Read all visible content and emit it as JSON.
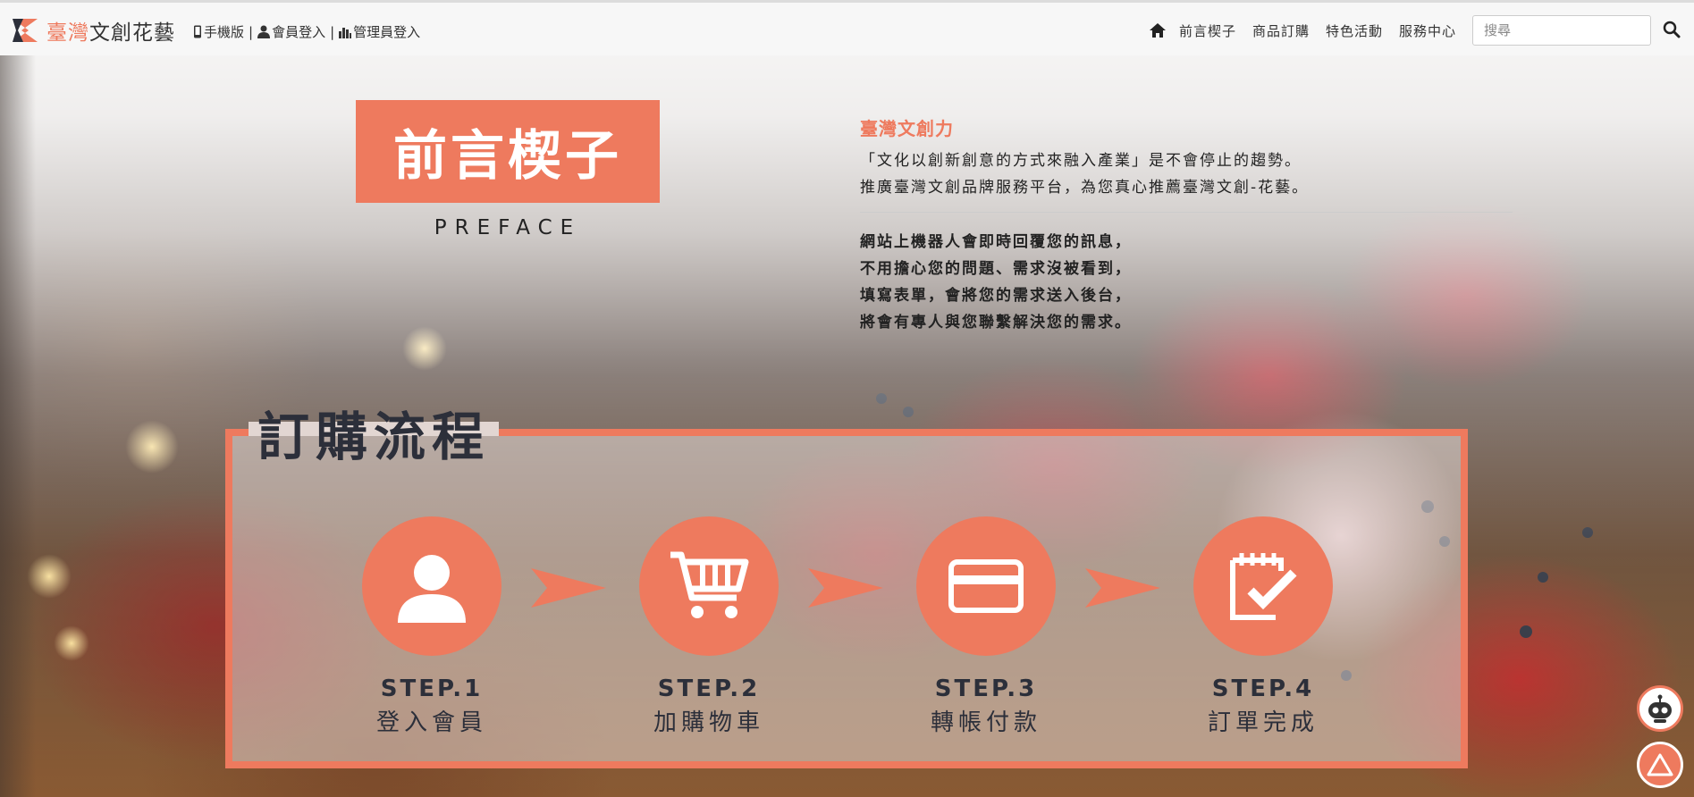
{
  "header": {
    "brand_part1": "臺灣",
    "brand_part2": "文創花藝",
    "mobile_label": "手機版",
    "member_login_label": "會員登入",
    "admin_login_label": "管理員登入",
    "separator": "|",
    "nav": {
      "preface": "前言楔子",
      "order": "商品訂購",
      "events": "特色活動",
      "service": "服務中心"
    },
    "search_placeholder": "搜尋"
  },
  "preface": {
    "title": "前言楔子",
    "subtitle": "PREFACE"
  },
  "intro": {
    "title": "臺灣文創力",
    "lines": [
      "「文化以創新創意的方式來融入產業」是不會停止的趨勢。",
      "推廣臺灣文創品牌服務平台，為您真心推薦臺灣文創-花藝。"
    ],
    "sub_lines": [
      "網站上機器人會即時回覆您的訊息，",
      "不用擔心您的問題、需求沒被看到，",
      "填寫表單，會將您的需求送入後台，",
      "將會有專人與您聯繫解決您的需求。"
    ]
  },
  "process": {
    "title": "訂購流程",
    "steps": [
      {
        "label": "STEP.1",
        "name": "登入會員"
      },
      {
        "label": "STEP.2",
        "name": "加購物車"
      },
      {
        "label": "STEP.3",
        "name": "轉帳付款"
      },
      {
        "label": "STEP.4",
        "name": "訂單完成"
      }
    ]
  },
  "colors": {
    "accent": "#ee7a5e",
    "dark_text": "#2c2f3a"
  }
}
